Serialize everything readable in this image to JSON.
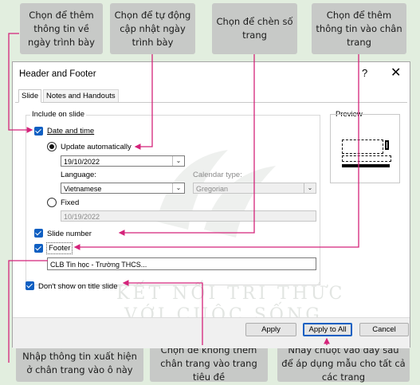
{
  "callouts": {
    "c1": "Chọn để thêm thông tin về ngày trình bày",
    "c2": "Chọn để tự động cập nhật ngày trình bày",
    "c3": "Chọn để chèn số trang",
    "c4": "Chọn để thêm thông tin vào chân trang",
    "c5": "Nhập thông tin xuất hiện ở chân trang vào ô này",
    "c6": "Chọn để không thêm chân trang vào trang tiêu đề",
    "c7": "Nháy chuột vào đây sau để áp dụng mẫu cho tất cả các trang"
  },
  "dialog": {
    "title": "Header and Footer",
    "help": "?",
    "close": "✕",
    "tabs": [
      "Slide",
      "Notes and Handouts"
    ],
    "include_legend": "Include on slide",
    "date_time": "Date and time",
    "update_auto": "Update automatically",
    "date_value": "19/10/2022",
    "language_label": "Language:",
    "language_value": "Vietnamese",
    "calendar_label": "Calendar type:",
    "calendar_value": "Gregorian",
    "fixed": "Fixed",
    "fixed_value": "10/19/2022",
    "slide_number": "Slide number",
    "footer": "Footer",
    "footer_value": "CLB Tin học - Trường THCS...",
    "dont_show": "Don't show on title slide",
    "preview": "Preview",
    "apply": "Apply",
    "apply_all": "Apply to All",
    "cancel": "Cancel"
  },
  "watermark": {
    "line1": "KẾT NỐI TRI THỨC",
    "line2": "VỚI CUỘC SỐNG"
  },
  "colors": {
    "background": "#e2eedf",
    "callout": "#c7c9c7",
    "arrow": "#d4237a",
    "checkbox": "#0f5fc2"
  }
}
